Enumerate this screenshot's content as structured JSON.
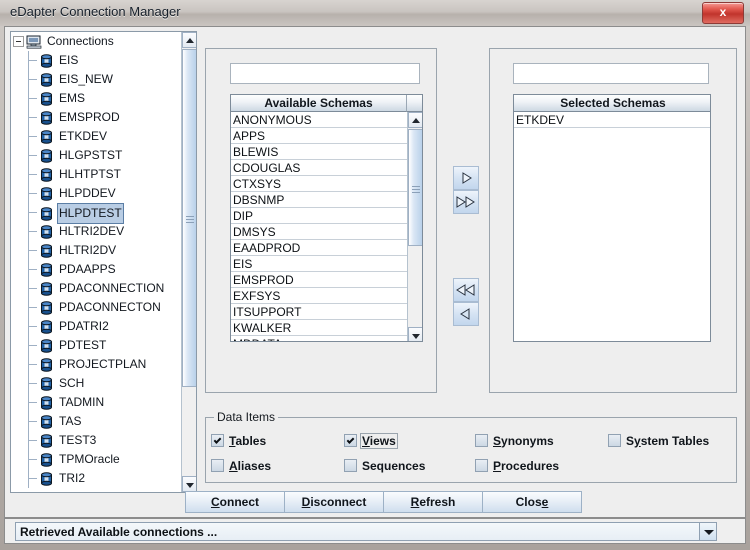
{
  "window": {
    "title": "eDapter Connection Manager",
    "close_label": "x"
  },
  "tree": {
    "root": {
      "label": "Connections",
      "icon": "computer-icon",
      "expanded": true
    },
    "items": [
      {
        "label": "EIS",
        "icon": "database-icon",
        "selected": false
      },
      {
        "label": "EIS_NEW",
        "icon": "database-icon",
        "selected": false
      },
      {
        "label": "EMS",
        "icon": "database-icon",
        "selected": false
      },
      {
        "label": "EMSPROD",
        "icon": "database-icon",
        "selected": false
      },
      {
        "label": "ETKDEV",
        "icon": "database-icon",
        "selected": false
      },
      {
        "label": "HLGPSTST",
        "icon": "database-icon",
        "selected": false
      },
      {
        "label": "HLHTPTST",
        "icon": "database-icon",
        "selected": false
      },
      {
        "label": "HLPDDEV",
        "icon": "database-icon",
        "selected": false
      },
      {
        "label": "HLPDTEST",
        "icon": "database-icon",
        "selected": true
      },
      {
        "label": "HLTRI2DEV",
        "icon": "database-icon",
        "selected": false
      },
      {
        "label": "HLTRI2DV",
        "icon": "database-icon",
        "selected": false
      },
      {
        "label": "PDAAPPS",
        "icon": "database-icon",
        "selected": false
      },
      {
        "label": "PDACONNECTION",
        "icon": "database-icon",
        "selected": false
      },
      {
        "label": "PDACONNECTON",
        "icon": "database-icon",
        "selected": false
      },
      {
        "label": "PDATRI2",
        "icon": "database-icon",
        "selected": false
      },
      {
        "label": "PDTEST",
        "icon": "database-icon",
        "selected": false
      },
      {
        "label": "PROJECTPLAN",
        "icon": "database-icon",
        "selected": false
      },
      {
        "label": "SCH",
        "icon": "database-icon",
        "selected": false
      },
      {
        "label": "TADMIN",
        "icon": "database-icon",
        "selected": false
      },
      {
        "label": "TAS",
        "icon": "database-icon",
        "selected": false
      },
      {
        "label": "TEST3",
        "icon": "database-icon",
        "selected": false
      },
      {
        "label": "TPMOracle",
        "icon": "database-icon",
        "selected": false
      },
      {
        "label": "TRI2",
        "icon": "database-icon",
        "selected": false
      }
    ]
  },
  "available": {
    "filter_value": "",
    "filter_placeholder": "",
    "header": "Available Schemas",
    "rows": [
      "ANONYMOUS",
      "APPS",
      "BLEWIS",
      "CDOUGLAS",
      "CTXSYS",
      "DBSNMP",
      "DIP",
      "DMSYS",
      "EAADPROD",
      "EIS",
      "EMSPROD",
      "EXFSYS",
      "ITSUPPORT",
      "KWALKER",
      "MDDATA"
    ]
  },
  "selected": {
    "filter_value": "",
    "filter_placeholder": "",
    "header": "Selected Schemas",
    "rows": [
      "ETKDEV"
    ]
  },
  "transfer_buttons": [
    {
      "name": "move-right-icon",
      "glyph": "single-right"
    },
    {
      "name": "move-all-right-icon",
      "glyph": "double-right"
    },
    {
      "name": "move-all-left-icon",
      "glyph": "double-left"
    },
    {
      "name": "move-left-icon",
      "glyph": "single-left"
    }
  ],
  "data_items": {
    "title": "Data Items",
    "checkboxes": [
      {
        "label": "Tables",
        "mnemonic": "T",
        "checked": true,
        "focused": false
      },
      {
        "label": "Views",
        "mnemonic": "V",
        "checked": true,
        "focused": true
      },
      {
        "label": "Synonyms",
        "mnemonic": "S",
        "checked": false,
        "focused": false
      },
      {
        "label": "System Tables",
        "mnemonic": "y",
        "checked": false,
        "focused": false
      },
      {
        "label": "Aliases",
        "mnemonic": "A",
        "checked": false,
        "focused": false
      },
      {
        "label": "Sequences",
        "mnemonic": "",
        "checked": false,
        "focused": false
      },
      {
        "label": "Procedures",
        "mnemonic": "P",
        "checked": false,
        "focused": false
      }
    ]
  },
  "buttons": [
    {
      "label": "Connect",
      "mnemonic": "C"
    },
    {
      "label": "Disconnect",
      "mnemonic": "D"
    },
    {
      "label": "Refresh",
      "mnemonic": "R"
    },
    {
      "label": "Close",
      "mnemonic": "e"
    }
  ],
  "status": {
    "text": "Retrieved Available connections ..."
  },
  "colors": {
    "selection": "#b9cde4",
    "close_button": "#c1342c",
    "panel_bg": "#eeeeee",
    "list_bg": "#ffffff"
  }
}
